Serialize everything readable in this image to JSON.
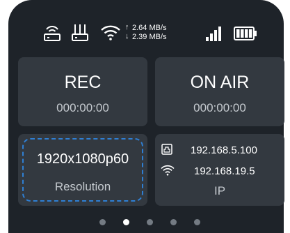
{
  "status_bar": {
    "icons": [
      "router-icon",
      "network-device-icon",
      "wifi-icon",
      "cellular-signal-icon",
      "battery-icon"
    ],
    "upload_speed": "2.64 MB/s",
    "download_speed": "2.39 MB/s",
    "upload_arrow": "↑",
    "download_arrow": "↓",
    "signal_bars_filled": 4,
    "battery_level": 1.0
  },
  "tiles": {
    "record": {
      "title": "REC",
      "time": "000:00:00"
    },
    "stream": {
      "title": "ON AIR",
      "time": "000:00:00"
    },
    "resolution": {
      "value": "1920x1080p60",
      "label": "Resolution",
      "selected": true
    },
    "network": {
      "ethernet_ip": "192.168.5.100",
      "wifi_ip": "192.168.19.5",
      "label": "IP",
      "icons": [
        "ethernet-icon",
        "wifi-icon"
      ]
    }
  },
  "pager": {
    "count": 5,
    "active_index": 1
  },
  "colors": {
    "background": "#1e2329",
    "tile": "#333940",
    "selection": "#2f7fd3",
    "text": "#ffffff"
  }
}
